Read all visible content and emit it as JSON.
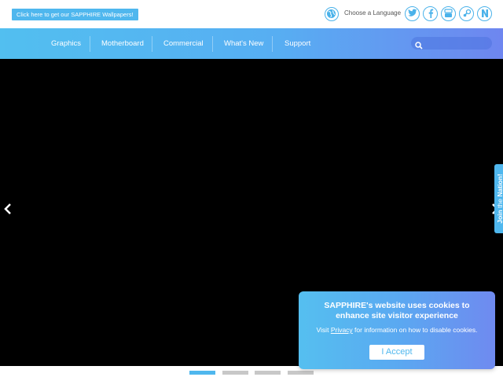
{
  "topbar": {
    "wallpaper_button": "Click here to get our SAPPHIRE Wallpapers!",
    "language_label": "Choose a Language",
    "social_icons": [
      "twitter-icon",
      "facebook-icon",
      "youtube-icon",
      "steam-icon",
      "n-icon"
    ]
  },
  "nav": {
    "items": [
      "Graphics",
      "Motherboard",
      "Commercial",
      "What's New",
      "Support"
    ],
    "search_placeholder": ""
  },
  "hero": {
    "prev_arrow": "‹",
    "next_arrow": "›",
    "join_tab": {
      "prefix": "Join",
      "middle": " the ",
      "suffix": "Nation!"
    }
  },
  "carousel": {
    "slide_count": 4,
    "active_index": 0
  },
  "cookie": {
    "title_line1": "SAPPHIRE's website uses cookies to",
    "title_line2": "enhance site visitor experience",
    "text_before": "Visit ",
    "link": "Privacy",
    "text_after": " for information on how to disable cookies.",
    "accept": "I Accept"
  },
  "colors": {
    "accent": "#4fb7ee",
    "nav_start": "#52bff0",
    "nav_end": "#6e86f0"
  }
}
